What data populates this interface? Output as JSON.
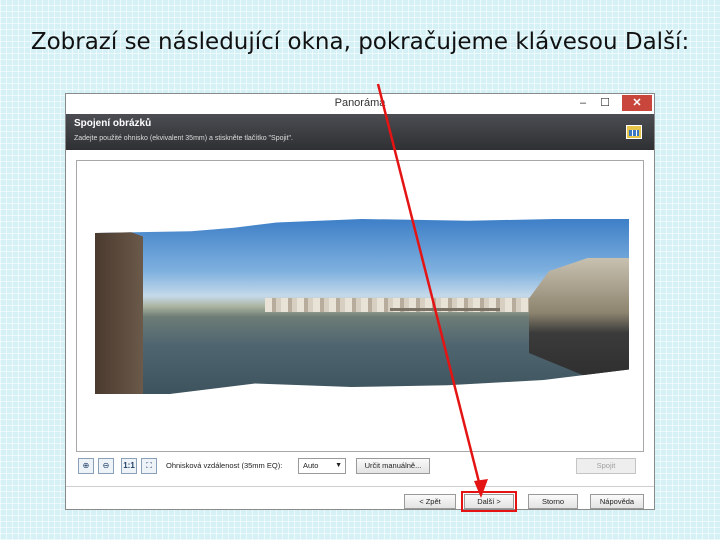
{
  "slide": {
    "title": "Zobrazí se následující okna, pokračujeme klávesou Další:"
  },
  "window": {
    "title": "Panoráma",
    "controls": {
      "minimize": "–",
      "maximize": "☐",
      "close": "✕"
    }
  },
  "header": {
    "title": "Spojení obrázků",
    "description": "Zadejte použité ohnisko (ekvivalent 35mm) a stiskněte tlačítko \"Spojit\".",
    "icon": "panorama-icon"
  },
  "toolbar": {
    "zoom_in_icon": "⊕",
    "zoom_out_icon": "⊖",
    "actual_size_label": "1:1",
    "fit_icon": "⛶",
    "focal_label": "Ohnisková vzdálenost (35mm EQ):",
    "focal_value": "Auto",
    "manual_label": "Určit manuálně...",
    "stitch_label": "Spojit"
  },
  "nav": {
    "back": "< Zpět",
    "next": "Další >",
    "cancel": "Storno",
    "help": "Nápověda"
  },
  "colors": {
    "highlight": "#e51414",
    "header_bg": "#3a3b3f"
  }
}
